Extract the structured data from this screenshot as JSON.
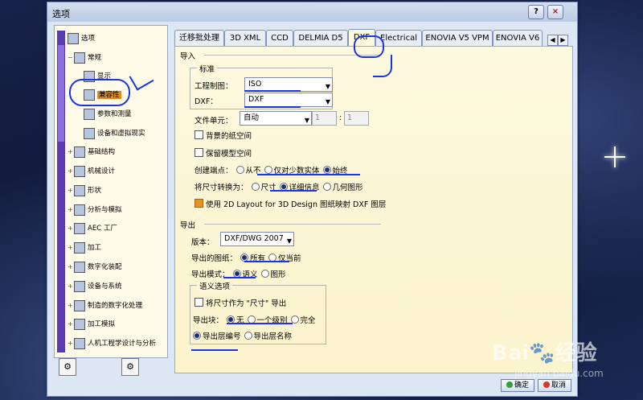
{
  "window": {
    "title": "选项",
    "help_glyph": "?",
    "close_glyph": "×"
  },
  "tree": {
    "items": [
      {
        "label": "选项"
      },
      {
        "label": "常规"
      },
      {
        "label": "显示"
      },
      {
        "label": "兼容性"
      },
      {
        "label": "参数和测量"
      },
      {
        "label": "设备和虚拟现实"
      },
      {
        "label": "基础结构"
      },
      {
        "label": "机械设计"
      },
      {
        "label": "形状"
      },
      {
        "label": "分析与模拟"
      },
      {
        "label": "AEC 工厂"
      },
      {
        "label": "加工"
      },
      {
        "label": "数字化装配"
      },
      {
        "label": "设备与系统"
      },
      {
        "label": "制造的数字化处理"
      },
      {
        "label": "加工模拟"
      },
      {
        "label": "人机工程学设计与分析"
      }
    ]
  },
  "tabs": [
    "迁移批处理",
    "3D XML",
    "CCD",
    "DELMIA D5",
    "DXF",
    "Electrical",
    "ENOVIA V5 VPM",
    "ENOVIA V6"
  ],
  "active_tab": "DXF",
  "import": {
    "section": "导入",
    "standard_group": "标准",
    "drawing_label": "工程制图：",
    "drawing_value": "ISO",
    "dxf_label": "DXF：",
    "dxf_value": "DXF",
    "file_unit_label": "文件单元：",
    "file_unit_value": "自动",
    "spin1": "1",
    "spin_sep": ":",
    "spin2": "1",
    "bg_paper_space": "背景的纸空间",
    "keep_model_space": "保留模型空间",
    "create_point_label": "创建端点：",
    "create_point_opts": [
      "从不",
      "仅对少数实体",
      "始终"
    ],
    "dim_convert_label": "将尺寸转换为：",
    "dim_convert_opts": [
      "尺寸",
      "详细信息",
      "几何图形"
    ],
    "use_2d_layout": "使用 2D Layout for 3D Design 图纸映射 DXF 图层"
  },
  "export": {
    "section": "导出",
    "version_label": "版本：",
    "version_value": "DXF/DWG 2007",
    "sheets_label": "导出的图纸：",
    "sheets_opts": [
      "所有",
      "仅当前"
    ],
    "mode_label": "导出模式：",
    "mode_opts": [
      "语义",
      "图形"
    ],
    "semantic_group": "语义选项",
    "export_dim_as": "将尺寸作为 \"尺寸\" 导出",
    "export_block_label": "导出块：",
    "export_block_opts": [
      "无",
      "一个级别",
      "完全"
    ],
    "layer_opts": [
      "导出层编号",
      "导出层名称"
    ]
  },
  "footer": {
    "ok": "确定",
    "cancel": "取消"
  },
  "watermark": {
    "brand": "Bai",
    "brand2": "经验",
    "url": "jingyan.baidu.com"
  },
  "colors": {
    "selection": "#e08a1e",
    "annotation_ink": "#1c33e6"
  }
}
